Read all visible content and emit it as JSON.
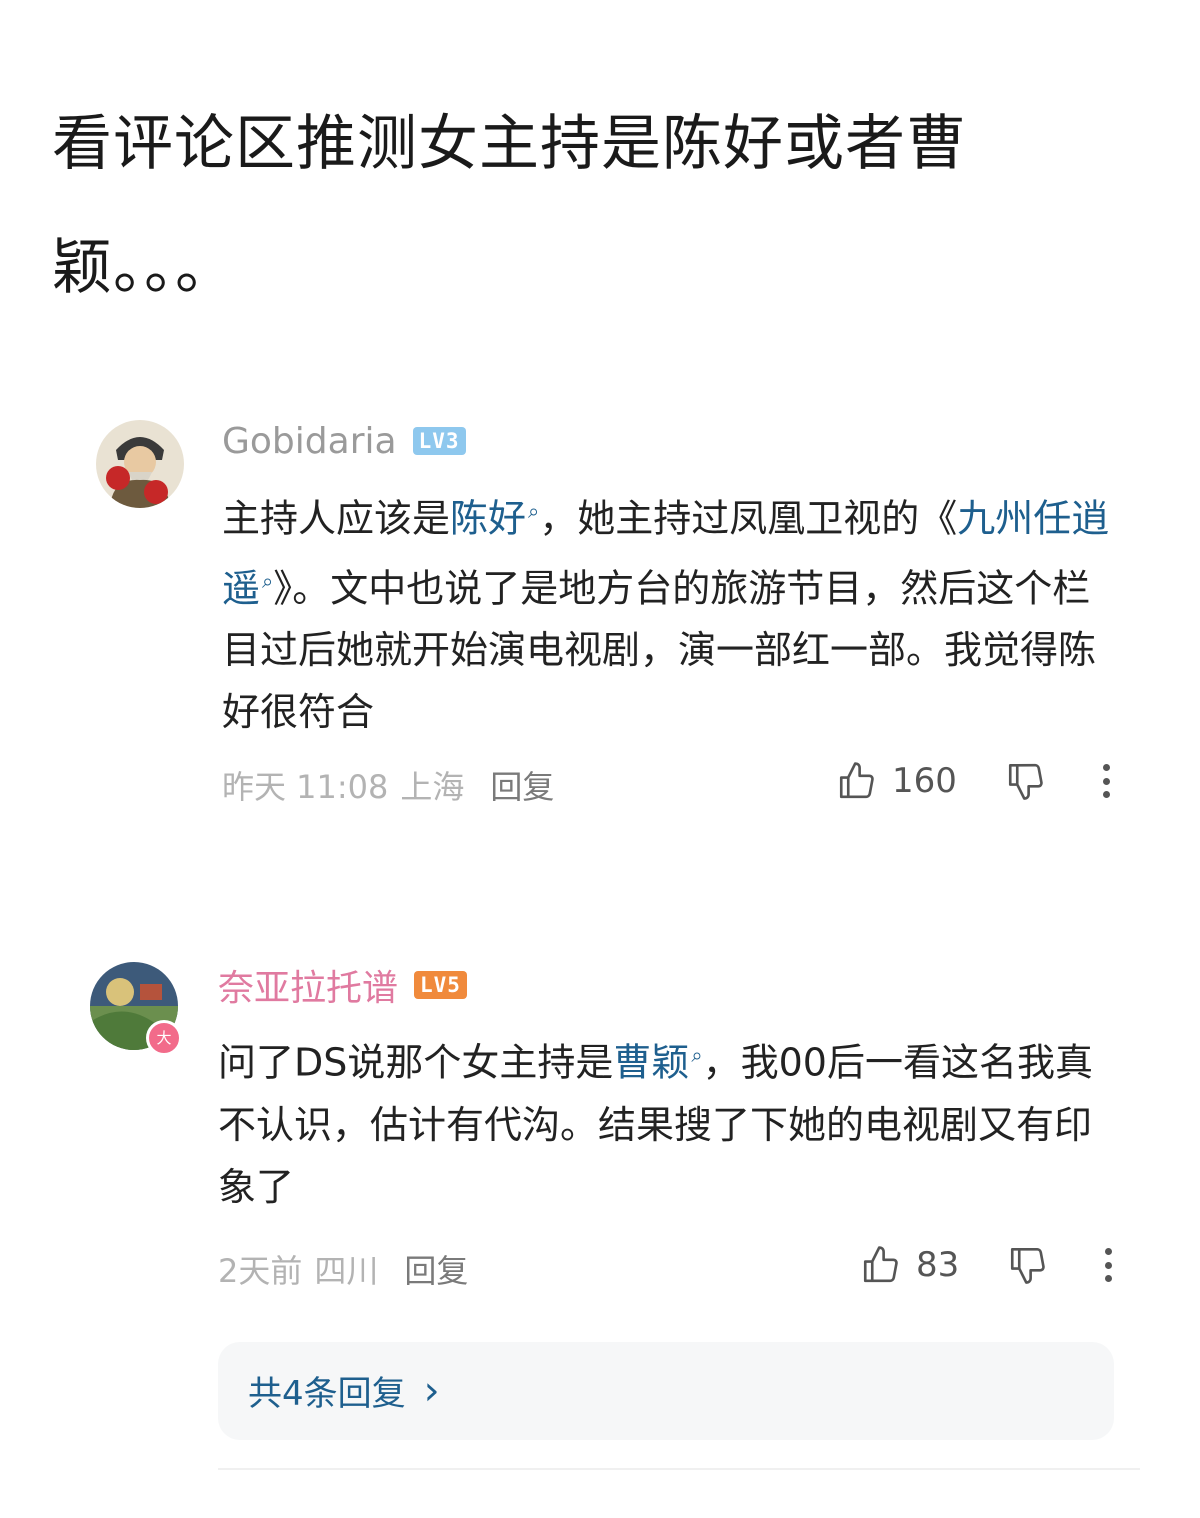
{
  "post": {
    "headline": "看评论区推测女主持是陈好或者曹颖。。。"
  },
  "comments": [
    {
      "username": "Gobidaria",
      "username_color": "#9a9a9a",
      "level": "LV3",
      "level_color": "#8ec8ee",
      "body_parts": {
        "p1": "主持人应该是",
        "kw1": "陈好",
        "p2": "，她主持过凤凰卫视的《",
        "kw2": "九州任逍遥",
        "p3": "》。文中也说了是地方台的旅游节目，然后这个栏目过后她就开始演电视剧，演一部红一部。我觉得陈好很符合"
      },
      "time": "昨天 11:08",
      "location": "上海",
      "reply_label": "回复",
      "likes": "160"
    },
    {
      "username": "奈亚拉托谱",
      "username_color": "#e07aa0",
      "level": "LV5",
      "level_color": "#f08a3c",
      "avatar_badge": "大",
      "body_parts": {
        "p1": "问了DS说那个女主持是",
        "kw1": "曹颖",
        "p2": "，我00后一看这名我真不认识，估计有代沟。结果搜了下她的电视剧又有印象了"
      },
      "time": "2天前",
      "location": "四川",
      "reply_label": "回复",
      "likes": "83"
    }
  ],
  "replies_link": {
    "label": "共4条回复",
    "arrow": "›"
  },
  "icons": {
    "keyword_search": "search-icon",
    "like": "thumbs-up-icon",
    "dislike": "thumbs-down-icon",
    "more": "more-vertical-icon"
  },
  "colors": {
    "keyword": "#1e5f8e",
    "meta": "#b3b3b3"
  }
}
